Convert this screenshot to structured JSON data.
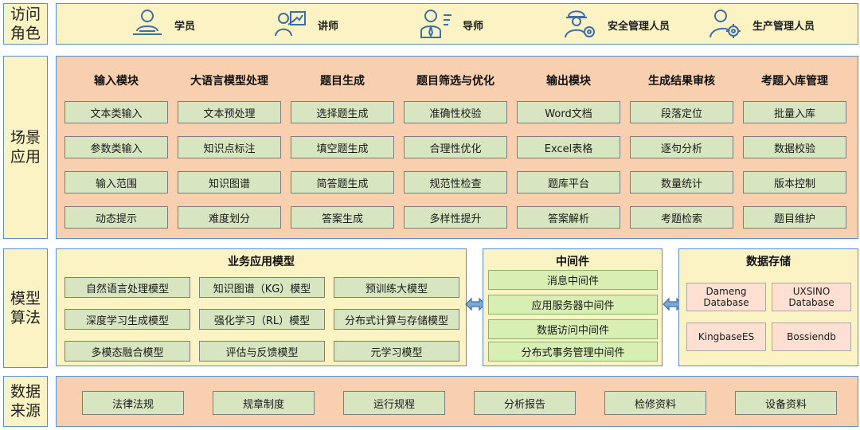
{
  "rows": {
    "access": "访问\n角色",
    "scenario": "场景\n应用",
    "model": "模型\n算法",
    "data": "数据\n来源"
  },
  "roles": [
    {
      "label": "学员",
      "icon": "student-icon"
    },
    {
      "label": "讲师",
      "icon": "lecturer-icon"
    },
    {
      "label": "导师",
      "icon": "mentor-icon"
    },
    {
      "label": "安全管理人员",
      "icon": "safety-manager-icon"
    },
    {
      "label": "生产管理人员",
      "icon": "production-manager-icon"
    }
  ],
  "scenario": {
    "columns": [
      {
        "title": "输入模块",
        "items": [
          "文本类输入",
          "参数类输入",
          "输入范围",
          "动态提示"
        ]
      },
      {
        "title": "大语言模型处理",
        "items": [
          "文本预处理",
          "知识点标注",
          "知识图谱",
          "难度划分"
        ]
      },
      {
        "title": "题目生成",
        "items": [
          "选择题生成",
          "填空题生成",
          "简答题生成",
          "答案生成"
        ]
      },
      {
        "title": "题目筛选与优化",
        "items": [
          "准确性校验",
          "合理性优化",
          "规范性检查",
          "多样性提升"
        ]
      },
      {
        "title": "输出模块",
        "items": [
          "Word文档",
          "Excel表格",
          "题库平台",
          "答案解析"
        ]
      },
      {
        "title": "生成结果审核",
        "items": [
          "段落定位",
          "逐句分析",
          "数量统计",
          "考题检索"
        ]
      },
      {
        "title": "考题入库管理",
        "items": [
          "批量入库",
          "数据校验",
          "版本控制",
          "题目维护"
        ]
      }
    ]
  },
  "business_models": {
    "title": "业务应用模型",
    "items": [
      "自然语言处理模型",
      "知识图谱（KG）模型",
      "预训练大模型",
      "深度学习生成模型",
      "强化学习（RL）模型",
      "分布式计算与存储模型",
      "多模态融合模型",
      "评估与反馈模型",
      "元学习模型"
    ]
  },
  "middleware": {
    "title": "中间件",
    "items": [
      "消息中间件",
      "应用服务器中间件",
      "数据访问中间件",
      "分布式事务管理中间件"
    ]
  },
  "storage": {
    "title": "数据存储",
    "items": [
      "Dameng\nDatabase",
      "UXSINO\nDatabase",
      "KingbaseES",
      "Bossiendb"
    ]
  },
  "data_sources": [
    "法律法规",
    "规章制度",
    "运行规程",
    "分析报告",
    "检修资料",
    "设备资料"
  ],
  "colors": {
    "border": "#5b8fc9",
    "yellow": "#fbf3c4",
    "peach": "#f8cfaf",
    "green_cell": "#d7e5c0",
    "icon": "#3e6ea8",
    "arrow": "#7ea8d6"
  }
}
